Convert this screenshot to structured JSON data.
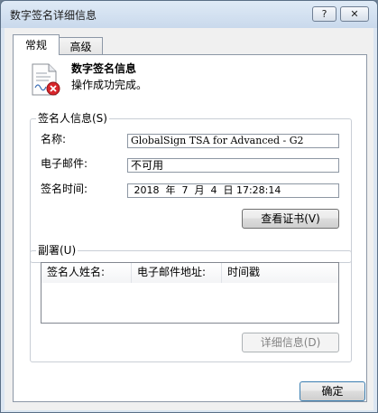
{
  "window": {
    "title": "数字签名详细信息",
    "help_label": "?",
    "close_label": "✕"
  },
  "tabs": [
    {
      "label": "常规"
    },
    {
      "label": "高级"
    }
  ],
  "header": {
    "title": "数字签名信息",
    "status": "操作成功完成。",
    "icon": "certificate-error-icon"
  },
  "signer_group": {
    "label": "签名人信息(S)",
    "name_label": "名称:",
    "name_value": "GlobalSign TSA for Advanced - G2",
    "email_label": "电子邮件:",
    "email_value": "不可用",
    "time_label": "签名时间:",
    "time_value": " 2018  年  7  月  4  日 17:28:14",
    "view_cert_label": "查看证书(V)"
  },
  "countersig_group": {
    "label": "副署(U)",
    "columns": [
      "签名人姓名:",
      "电子邮件地址:",
      "时间戳"
    ],
    "rows": [],
    "details_label": "详细信息(D)"
  },
  "footer": {
    "ok_label": "确定"
  }
}
